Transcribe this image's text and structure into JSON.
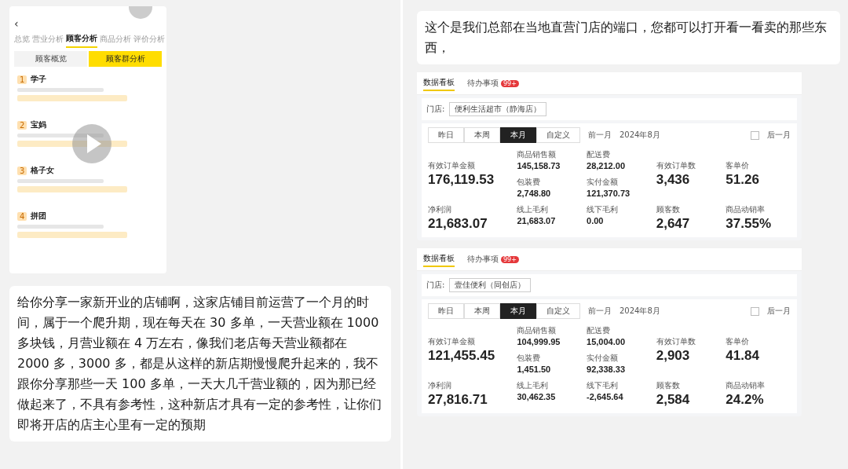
{
  "left_pane": {
    "phone_screenshot": {
      "back": "‹",
      "tabs": [
        {
          "label": "总览",
          "selected": false
        },
        {
          "label": "营业分析",
          "selected": false
        },
        {
          "label": "顾客分析",
          "selected": true
        },
        {
          "label": "商品分析",
          "selected": false
        },
        {
          "label": "评价分析",
          "selected": false
        }
      ],
      "segments": [
        {
          "label": "顾客概览",
          "selected": false
        },
        {
          "label": "顾客群分析",
          "selected": true
        }
      ],
      "groups": [
        {
          "rank": "1",
          "name": "学子"
        },
        {
          "rank": "2",
          "name": "宝妈"
        },
        {
          "rank": "3",
          "name": "格子女"
        },
        {
          "rank": "4",
          "name": "拼团"
        }
      ]
    },
    "message": "给你分享一家新开业的店铺啊，这家店铺目前运营了一个月的时间，属于一个爬升期，现在每天在 30 多单，一天营业额在 1000 多块钱，月营业额在 4 万左右，像我们老店每天营业额都在 2000 多，3000 多，都是从这样的新店期慢慢爬升起来的，我不跟你分享那些一天 100 多单，一天大几千营业额的，因为那已经做起来了，不具有参考性，这种新店才具有一定的参考性，让你们即将开店的店主心里有一定的预期"
  },
  "right_pane": {
    "message": "这个是我们总部在当地直营门店的端口，您都可以打开看一看卖的那些东西，",
    "dashboards": [
      {
        "tabs": [
          {
            "label": "数据看板",
            "selected": true
          },
          {
            "label": "待办事项",
            "selected": false,
            "badge": "99+"
          }
        ],
        "store_label": "门店:",
        "store": "便利生活超市（静海店）",
        "periods": [
          {
            "label": "昨日",
            "selected": false
          },
          {
            "label": "本周",
            "selected": false
          },
          {
            "label": "本月",
            "selected": true
          },
          {
            "label": "自定义",
            "selected": false
          }
        ],
        "prev": "前一月",
        "month": "2024年8月",
        "checked": false,
        "next": "后一月",
        "metrics": [
          {
            "label": "有效订单金额",
            "value": "176,119.53",
            "kind": "large"
          },
          {
            "label": "商品销售额",
            "value": "145,158.73",
            "kind": "small"
          },
          {
            "label": "配送费",
            "value": "28,212.00",
            "kind": "small"
          },
          {
            "label": "有效订单数",
            "value": "3,436",
            "kind": "large"
          },
          {
            "label": "客单价",
            "value": "51.26",
            "kind": "large"
          },
          {
            "label": "包装费",
            "value": "2,748.80",
            "kind": "small"
          },
          {
            "label": "实付金额",
            "value": "121,370.73",
            "kind": "small"
          },
          {
            "label": "净利润",
            "value": "21,683.07",
            "kind": "large"
          },
          {
            "label": "线上毛利",
            "value": "21,683.07",
            "kind": "small"
          },
          {
            "label": "线下毛利",
            "value": "0.00",
            "kind": "small"
          },
          {
            "label": "顾客数",
            "value": "2,647",
            "kind": "large"
          },
          {
            "label": "商品动销率",
            "value": "37.55%",
            "kind": "large"
          }
        ]
      },
      {
        "tabs": [
          {
            "label": "数据看板",
            "selected": true
          },
          {
            "label": "待办事项",
            "selected": false,
            "badge": "99+"
          }
        ],
        "store_label": "门店:",
        "store": "壹佳便利（同创店）",
        "periods": [
          {
            "label": "昨日",
            "selected": false
          },
          {
            "label": "本周",
            "selected": false
          },
          {
            "label": "本月",
            "selected": true
          },
          {
            "label": "自定义",
            "selected": false
          }
        ],
        "prev": "前一月",
        "month": "2024年8月",
        "checked": false,
        "next": "后一月",
        "metrics": [
          {
            "label": "有效订单金额",
            "value": "121,455.45",
            "kind": "large"
          },
          {
            "label": "商品销售额",
            "value": "104,999.95",
            "kind": "small"
          },
          {
            "label": "配送费",
            "value": "15,004.00",
            "kind": "small"
          },
          {
            "label": "有效订单数",
            "value": "2,903",
            "kind": "large"
          },
          {
            "label": "客单价",
            "value": "41.84",
            "kind": "large"
          },
          {
            "label": "包装费",
            "value": "1,451.50",
            "kind": "small"
          },
          {
            "label": "实付金额",
            "value": "92,338.33",
            "kind": "small"
          },
          {
            "label": "净利润",
            "value": "27,816.71",
            "kind": "large"
          },
          {
            "label": "线上毛利",
            "value": "30,462.35",
            "kind": "small"
          },
          {
            "label": "线下毛利",
            "value": "-2,645.64",
            "kind": "small"
          },
          {
            "label": "顾客数",
            "value": "2,584",
            "kind": "large"
          },
          {
            "label": "商品动销率",
            "value": "24.2%",
            "kind": "large"
          }
        ]
      }
    ]
  }
}
